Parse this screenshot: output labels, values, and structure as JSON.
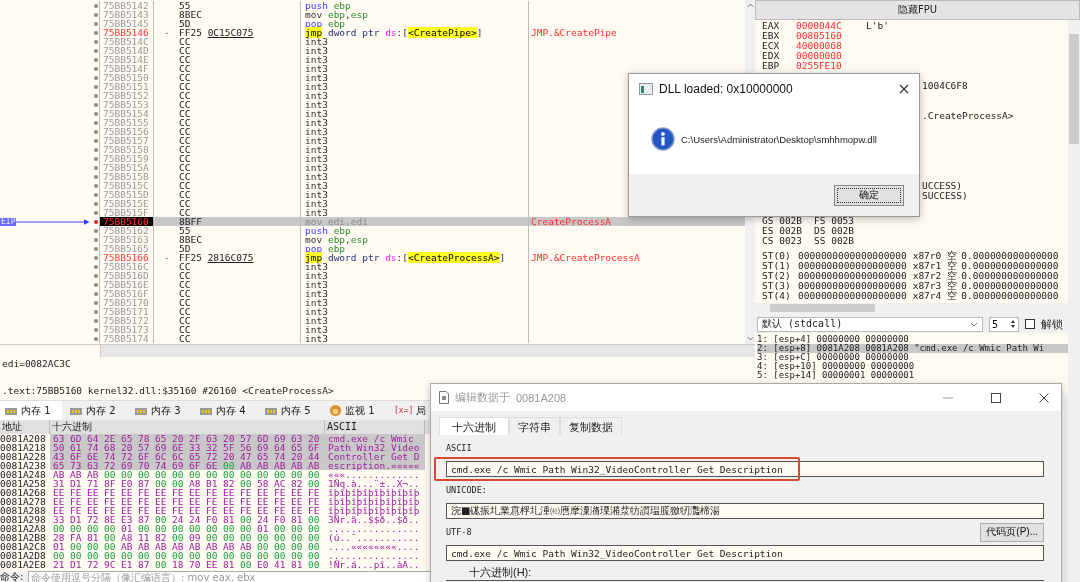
{
  "disassembly": {
    "eip_label": "EIP",
    "rows": [
      {
        "address": "75BB5142",
        "bytes": "55",
        "ins": [
          {
            "text": "push",
            "kind": "stack"
          },
          {
            "text": "ebp",
            "kind": "reg"
          }
        ],
        "kind": "plain",
        "selected": false
      },
      {
        "address": "75BB5143",
        "bytes": "8BEC",
        "ins": [
          {
            "text": "mov",
            "kind": "op"
          },
          {
            "text": "ebp",
            "kind": "reg"
          },
          {
            "text": ",",
            "kind": "punct"
          },
          {
            "text": "esp",
            "kind": "reg"
          }
        ],
        "kind": "plain",
        "selected": false
      },
      {
        "address": "75BB5145",
        "bytes": "5D",
        "ins": [
          {
            "text": "pop",
            "kind": "stack"
          },
          {
            "text": "ebp",
            "kind": "reg"
          }
        ],
        "kind": "plain",
        "selected": false
      },
      {
        "address": "75BB5146",
        "marker": "-",
        "bytes": "FF25",
        "operand": "0C15C075",
        "ins": [
          {
            "text": "jmp",
            "kind": "jump"
          },
          {
            "text": "dword ptr",
            "kind": "size"
          },
          {
            "text": "ds",
            "kind": "seg"
          },
          {
            "text": ":[",
            "kind": "punct"
          },
          {
            "text": "<CreatePipe>",
            "kind": "symbol"
          },
          {
            "text": "]",
            "kind": "punct"
          }
        ],
        "comment": "JMP.&CreatePipe",
        "kind": "jump",
        "selected": false
      },
      {
        "address": "75BB514C",
        "bytes": "CC",
        "ins": [
          {
            "text": "int3",
            "kind": "op"
          }
        ],
        "kind": "plain",
        "selected": false
      },
      {
        "address": "75BB514D",
        "bytes": "CC",
        "ins": [
          {
            "text": "int3",
            "kind": "op"
          }
        ],
        "kind": "plain",
        "selected": false
      },
      {
        "address": "75BB514E",
        "bytes": "CC",
        "ins": [
          {
            "text": "int3",
            "kind": "op"
          }
        ],
        "kind": "plain",
        "selected": false
      },
      {
        "address": "75BB514F",
        "bytes": "CC",
        "ins": [
          {
            "text": "int3",
            "kind": "op"
          }
        ],
        "kind": "plain",
        "selected": false
      },
      {
        "address": "75BB5150",
        "bytes": "CC",
        "ins": [
          {
            "text": "int3",
            "kind": "op"
          }
        ],
        "kind": "plain",
        "selected": false
      },
      {
        "address": "75BB5151",
        "bytes": "CC",
        "ins": [
          {
            "text": "int3",
            "kind": "op"
          }
        ],
        "kind": "plain",
        "selected": false
      },
      {
        "address": "75BB5152",
        "bytes": "CC",
        "ins": [
          {
            "text": "int3",
            "kind": "op"
          }
        ],
        "kind": "plain",
        "selected": false
      },
      {
        "address": "75BB5153",
        "bytes": "CC",
        "ins": [
          {
            "text": "int3",
            "kind": "op"
          }
        ],
        "kind": "plain",
        "selected": false
      },
      {
        "address": "75BB5154",
        "bytes": "CC",
        "ins": [
          {
            "text": "int3",
            "kind": "op"
          }
        ],
        "kind": "plain",
        "selected": false
      },
      {
        "address": "75BB5155",
        "bytes": "CC",
        "ins": [
          {
            "text": "int3",
            "kind": "op"
          }
        ],
        "kind": "plain",
        "selected": false
      },
      {
        "address": "75BB5156",
        "bytes": "CC",
        "ins": [
          {
            "text": "int3",
            "kind": "op"
          }
        ],
        "kind": "plain",
        "selected": false
      },
      {
        "address": "75BB5157",
        "bytes": "CC",
        "ins": [
          {
            "text": "int3",
            "kind": "op"
          }
        ],
        "kind": "plain",
        "selected": false
      },
      {
        "address": "75BB5158",
        "bytes": "CC",
        "ins": [
          {
            "text": "int3",
            "kind": "op"
          }
        ],
        "kind": "plain",
        "selected": false
      },
      {
        "address": "75BB5159",
        "bytes": "CC",
        "ins": [
          {
            "text": "int3",
            "kind": "op"
          }
        ],
        "kind": "plain",
        "selected": false
      },
      {
        "address": "75BB515A",
        "bytes": "CC",
        "ins": [
          {
            "text": "int3",
            "kind": "op"
          }
        ],
        "kind": "plain",
        "selected": false
      },
      {
        "address": "75BB515B",
        "bytes": "CC",
        "ins": [
          {
            "text": "int3",
            "kind": "op"
          }
        ],
        "kind": "plain",
        "selected": false
      },
      {
        "address": "75BB515C",
        "bytes": "CC",
        "ins": [
          {
            "text": "int3",
            "kind": "op"
          }
        ],
        "kind": "plain",
        "selected": false
      },
      {
        "address": "75BB515D",
        "bytes": "CC",
        "ins": [
          {
            "text": "int3",
            "kind": "op"
          }
        ],
        "kind": "plain",
        "selected": false
      },
      {
        "address": "75BB515E",
        "bytes": "CC",
        "ins": [
          {
            "text": "int3",
            "kind": "op"
          }
        ],
        "kind": "plain",
        "selected": false
      },
      {
        "address": "75BB515F",
        "bytes": "CC",
        "ins": [
          {
            "text": "int3",
            "kind": "op"
          }
        ],
        "kind": "plain",
        "selected": false
      },
      {
        "address": "75BB5160",
        "bytes": "8BFF",
        "ins": [
          {
            "text": "mov",
            "kind": "op"
          },
          {
            "text": "edi",
            "kind": "reg"
          },
          {
            "text": ",",
            "kind": "punct"
          },
          {
            "text": "edi",
            "kind": "reg"
          }
        ],
        "comment": "CreateProcessA",
        "kind": "plain",
        "selected": true
      },
      {
        "address": "75BB5162",
        "bytes": "55",
        "ins": [
          {
            "text": "push",
            "kind": "stack"
          },
          {
            "text": "ebp",
            "kind": "reg"
          }
        ],
        "kind": "plain",
        "selected": false
      },
      {
        "address": "75BB5163",
        "bytes": "8BEC",
        "ins": [
          {
            "text": "mov",
            "kind": "op"
          },
          {
            "text": "ebp",
            "kind": "reg"
          },
          {
            "text": ",",
            "kind": "punct"
          },
          {
            "text": "esp",
            "kind": "reg"
          }
        ],
        "kind": "plain",
        "selected": false
      },
      {
        "address": "75BB5165",
        "bytes": "5D",
        "ins": [
          {
            "text": "pop",
            "kind": "stack"
          },
          {
            "text": "ebp",
            "kind": "reg"
          }
        ],
        "kind": "plain",
        "selected": false
      },
      {
        "address": "75BB5166",
        "marker": "-",
        "bytes": "FF25",
        "operand": "2816C075",
        "ins": [
          {
            "text": "jmp",
            "kind": "jump"
          },
          {
            "text": "dword ptr",
            "kind": "size"
          },
          {
            "text": "ds",
            "kind": "seg"
          },
          {
            "text": ":[",
            "kind": "punct"
          },
          {
            "text": "<CreateProcessA>",
            "kind": "symbol"
          },
          {
            "text": "]",
            "kind": "punct"
          }
        ],
        "comment": "JMP.&CreateProcessA",
        "kind": "jump",
        "selected": false
      },
      {
        "address": "75BB516C",
        "bytes": "CC",
        "ins": [
          {
            "text": "int3",
            "kind": "op"
          }
        ],
        "kind": "plain",
        "selected": false
      },
      {
        "address": "75BB516D",
        "bytes": "CC",
        "ins": [
          {
            "text": "int3",
            "kind": "op"
          }
        ],
        "kind": "plain",
        "selected": false
      },
      {
        "address": "75BB516E",
        "bytes": "CC",
        "ins": [
          {
            "text": "int3",
            "kind": "op"
          }
        ],
        "kind": "plain",
        "selected": false
      },
      {
        "address": "75BB516F",
        "bytes": "CC",
        "ins": [
          {
            "text": "int3",
            "kind": "op"
          }
        ],
        "kind": "plain",
        "selected": false
      },
      {
        "address": "75BB5170",
        "bytes": "CC",
        "ins": [
          {
            "text": "int3",
            "kind": "op"
          }
        ],
        "kind": "plain",
        "selected": false
      },
      {
        "address": "75BB5171",
        "bytes": "CC",
        "ins": [
          {
            "text": "int3",
            "kind": "op"
          }
        ],
        "kind": "plain",
        "selected": false
      },
      {
        "address": "75BB5172",
        "bytes": "CC",
        "ins": [
          {
            "text": "int3",
            "kind": "op"
          }
        ],
        "kind": "plain",
        "selected": false
      },
      {
        "address": "75BB5173",
        "bytes": "CC",
        "ins": [
          {
            "text": "int3",
            "kind": "op"
          }
        ],
        "kind": "plain",
        "selected": false
      },
      {
        "address": "75BB5174",
        "bytes": "CC",
        "ins": [
          {
            "text": "int3",
            "kind": "op"
          }
        ],
        "kind": "plain",
        "selected": false
      }
    ]
  },
  "info": {
    "register_note": "edi=0082AC3C",
    "location": ".text:75BB5160 kernel32.dll:$35160 #26160 <CreateProcessA>"
  },
  "dump_tabs": [
    {
      "label": "内存 1",
      "kind": "memory",
      "selected": true
    },
    {
      "label": "内存 2",
      "kind": "memory",
      "selected": false
    },
    {
      "label": "内存 3",
      "kind": "memory",
      "selected": false
    },
    {
      "label": "内存 4",
      "kind": "memory",
      "selected": false
    },
    {
      "label": "内存 5",
      "kind": "memory",
      "selected": false
    },
    {
      "label": "监视 1",
      "kind": "watch",
      "selected": false
    },
    {
      "label": "局",
      "kind": "locals",
      "symbol": "[x=]",
      "selected": false
    }
  ],
  "dump": {
    "columns": [
      "地址",
      "十六进制",
      "ASCII"
    ],
    "rows": [
      {
        "address": "0081A208",
        "hex": "63 6D 64 2E 65 78 65 20 2F 63 20 57 6D 69 63 20",
        "ascii": "cmd.exe /c Wmic",
        "selected": true
      },
      {
        "address": "0081A218",
        "hex": "50 61 74 68 20 57 69 6E 33 32 5F 56 69 64 65 6F",
        "ascii": "Path Win32_Video",
        "selected": true
      },
      {
        "address": "0081A228",
        "hex": "43 6F 6E 74 72 6F 6C 6C 65 72 20 47 65 74 20 44",
        "ascii": "Controller Get D",
        "selected": true
      },
      {
        "address": "0081A238",
        "hex": "65 73 63 72 69 70 74 69 6F 6E 00 AB AB AB AB AB",
        "ascii": "escription.«««««",
        "selected": true
      },
      {
        "address": "0081A248",
        "hex": "AB AB AB 00 00 00 00 00 00 00 00 00 00 00 00 00",
        "ascii": "«««.............",
        "selected": false
      },
      {
        "address": "0081A258",
        "hex": "31 D1 71 8F E0 87 00 00 A8 B1 82 00 58 AC 82 00",
        "ascii": "1Ñq.à...¨±..X¬..",
        "selected": false
      },
      {
        "address": "0081A268",
        "hex": "EE FE EE FE EE FE EE FE EE FE EE FE EE FE EE FE",
        "ascii": "îþîþîþîþîþîþîþîþ",
        "selected": false
      },
      {
        "address": "0081A278",
        "hex": "EE FE EE FE EE FE EE FE EE FE EE FE EE FE EE FE",
        "ascii": "îþîþîþîþîþîþîþîþ",
        "selected": false
      },
      {
        "address": "0081A288",
        "hex": "EE FE EE FE EE FE EE FE EE FE EE FE EE FE EE FE",
        "ascii": "îþîþîþîþîþîþîþîþ",
        "selected": false
      },
      {
        "address": "0081A298",
        "hex": "33 D1 72 8E E3 87 00 24 24 F0 81 00 24 F0 81 00",
        "ascii": "3Ñr.ã..$$ð..$ð..",
        "selected": false
      },
      {
        "address": "0081A2A8",
        "hex": "00 00 00 00 01 00 00 00 00 00 00 00 01 00 00 00",
        "ascii": "................",
        "selected": false
      },
      {
        "address": "0081A2B8",
        "hex": "28 FA 81 00 A8 11 82 00 09 00 00 00 00 00 00 00",
        "ascii": "(ú..¨...........",
        "selected": false
      },
      {
        "address": "0081A2C8",
        "hex": "01 00 00 00 AB AB AB AB AB AB AB AB 00 00 00 00",
        "ascii": "....««««««««....",
        "selected": false
      },
      {
        "address": "0081A2D8",
        "hex": "00 00 00 00 00 00 00 00 00 00 00 00 00 00 00 00",
        "ascii": "................",
        "selected": false
      },
      {
        "address": "0081A2E8",
        "hex": "21 D1 72 9C E1 87 00 18 70 EE 81 00 E0 41 81 00",
        "ascii": "!Ñr.á...pî..àA..",
        "selected": false
      }
    ]
  },
  "command": {
    "label": "命令:",
    "placeholder": "命令使用逗号分隔（像汇编语言）: mov eax, ebx"
  },
  "registers": {
    "toggle_button": "隐藏FPU",
    "general": [
      {
        "name": "EAX",
        "value": "0000044C",
        "note": "L'b'",
        "changed": true
      },
      {
        "name": "EBX",
        "value": "00805160",
        "changed": true
      },
      {
        "name": "ECX",
        "value": "40000068",
        "changed": true
      },
      {
        "name": "EDX",
        "value": "00000000",
        "changed": true
      },
      {
        "name": "EBP",
        "value": "0255FE10",
        "changed": true
      }
    ],
    "fragments": [
      "1004C6F8",
      ".CreateProcessA>",
      "UCCESS)",
      "SUCCESS)"
    ],
    "segments": [
      "GS 002B",
      "FS 0053",
      "ES 002B",
      "DS 002B",
      "CS 0023",
      "SS 002B"
    ],
    "fpu": [
      {
        "name": "ST(0)",
        "raw": "0000000000000000000",
        "tag": "x87r0",
        "status": "空",
        "value": "0.000000000000000"
      },
      {
        "name": "ST(1)",
        "raw": "0000000000000000000",
        "tag": "x87r1",
        "status": "空",
        "value": "0.000000000000000"
      },
      {
        "name": "ST(2)",
        "raw": "0000000000000000000",
        "tag": "x87r2",
        "status": "空",
        "value": "0.000000000000000"
      },
      {
        "name": "ST(3)",
        "raw": "0000000000000000000",
        "tag": "x87r3",
        "status": "空",
        "value": "0.000000000000000"
      },
      {
        "name": "ST(4)",
        "raw": "0000000000000000000",
        "tag": "x87r4",
        "status": "空",
        "value": "0.000000000000000"
      }
    ]
  },
  "call_convention": {
    "value": "默认 (stdcall)",
    "count": "5",
    "unlock": {
      "label": "解锁",
      "checked": false
    }
  },
  "stack_args": [
    {
      "text": "1: [esp+4] 00000000 00000000",
      "selected": false
    },
    {
      "text": "2: [esp+8] 0081A208 0081A208 \"cmd.exe /c Wmic Path Wi",
      "selected": true
    },
    {
      "text": "3: [esp+C] 00000000 00000000",
      "selected": false
    },
    {
      "text": "4: [esp+10] 00000000 00000000",
      "selected": false
    },
    {
      "text": "5: [esp+14] 00000001 00000001",
      "selected": false
    }
  ],
  "dll_dialog": {
    "title": "DLL loaded: 0x10000000",
    "message": "C:\\Users\\Administrator\\Desktop\\smhhmopw.dll",
    "button": "确定"
  },
  "edit_dialog": {
    "title": "编辑数据于",
    "address": "0081A208",
    "tabs": [
      {
        "label": "十六进制",
        "selected": true
      },
      {
        "label": "字符串",
        "selected": false
      },
      {
        "label": "复制数据",
        "selected": false
      }
    ],
    "ascii_label": "ASCII",
    "ascii_value": "cmd.exe /c Wmic Path Win32_VideoController Get Description",
    "ascii_highlighted": true,
    "unicode_label": "UNICODE:",
    "unicode_value": "浣■硥振圠業慐桴圠湩㈳噟摩潥潃瑮潲汬牥䜠瑥䐠獥牣灩楴湯",
    "utf8_label": "UTF-8",
    "codepage_button": "代码页(P)...",
    "utf8_value": "cmd.exe /c Wmic Path Win32_VideoController Get Description",
    "hex_label": "十六进制(H):"
  }
}
